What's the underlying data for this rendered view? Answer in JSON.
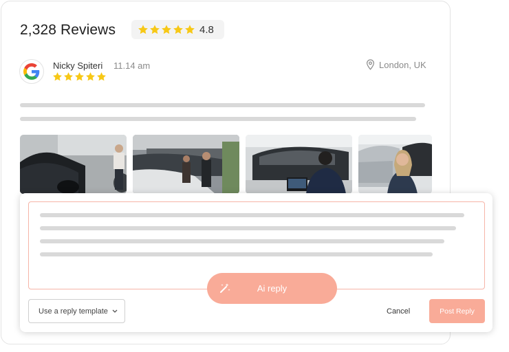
{
  "header": {
    "reviews_count_label": "2,328 Reviews",
    "rating_value": "4.8",
    "rating_stars": 5
  },
  "review": {
    "source_icon": "google-icon",
    "reviewer_name": "Nicky Spiteri",
    "time": "11.14 am",
    "stars": 5,
    "location": "London, UK",
    "location_icon": "location-pin-icon",
    "photos": [
      {
        "description_icon": "photo-car-showroom-woman"
      },
      {
        "description_icon": "photo-showroom-people"
      },
      {
        "description_icon": "photo-office-worker"
      },
      {
        "description_icon": "photo-smiling-woman-car"
      }
    ]
  },
  "reply": {
    "ai_reply_label": "Ai reply",
    "template_select_label": "Use a reply template",
    "cancel_label": "Cancel",
    "post_label": "Post Reply"
  },
  "colors": {
    "star": "#f7c816",
    "accent": "#f9ab98",
    "reply_border": "#f6b4a7",
    "skeleton": "#d9d9d9"
  }
}
